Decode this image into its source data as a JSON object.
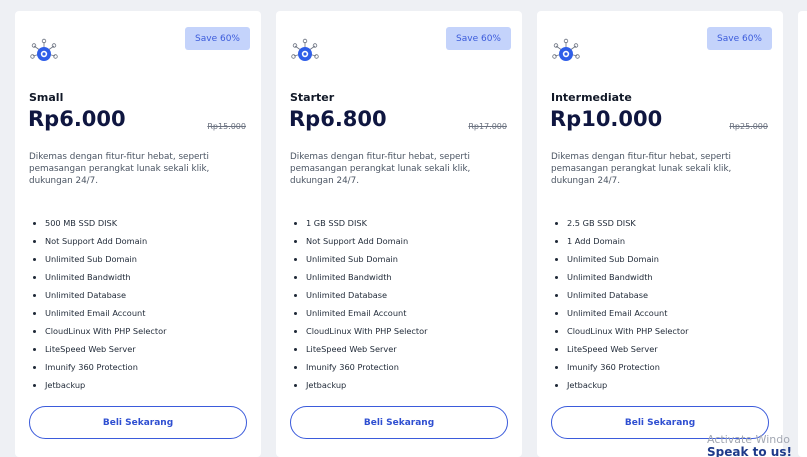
{
  "colors": {
    "accent": "#3b5bdb",
    "badge_bg": "#c4d3fb",
    "price": "#0f1640",
    "icon_blue": "#2f5ee8"
  },
  "plans": [
    {
      "badge": "Save 60%",
      "icon": "network-hub-icon",
      "name": "Small",
      "price": "Rp6.000",
      "old_price": "Rp15.000",
      "description": "Dikemas dengan fitur-fitur hebat, seperti pemasangan perangkat lunak sekali klik, dukungan 24/7.",
      "features": [
        "500 MB SSD DISK",
        "Not Support Add Domain",
        "Unlimited Sub Domain",
        "Unlimited Bandwidth",
        "Unlimited Database",
        "Unlimited Email Account",
        "CloudLinux With PHP Selector",
        "LiteSpeed Web Server",
        "Imunify 360 Protection",
        "Jetbackup"
      ],
      "button": "Beli Sekarang"
    },
    {
      "badge": "Save 60%",
      "icon": "network-hub-icon",
      "name": "Starter",
      "price": "Rp6.800",
      "old_price": "Rp17.000",
      "description": "Dikemas dengan fitur-fitur hebat, seperti pemasangan perangkat lunak sekali klik, dukungan 24/7.",
      "features": [
        "1 GB SSD DISK",
        "Not Support Add Domain",
        "Unlimited Sub Domain",
        "Unlimited Bandwidth",
        "Unlimited Database",
        "Unlimited Email Account",
        "CloudLinux With PHP Selector",
        "LiteSpeed Web Server",
        "Imunify 360 Protection",
        "Jetbackup"
      ],
      "button": "Beli Sekarang"
    },
    {
      "badge": "Save 60%",
      "icon": "network-hub-icon",
      "name": "Intermediate",
      "price": "Rp10.000",
      "old_price": "Rp25.000",
      "description": "Dikemas dengan fitur-fitur hebat, seperti pemasangan perangkat lunak sekali klik, dukungan 24/7.",
      "features": [
        "2.5 GB SSD DISK",
        "1 Add Domain",
        "Unlimited Sub Domain",
        "Unlimited Bandwidth",
        "Unlimited Database",
        "Unlimited Email Account",
        "CloudLinux With PHP Selector",
        "LiteSpeed Web Server",
        "Imunify 360 Protection",
        "Jetbackup"
      ],
      "button": "Beli Sekarang"
    }
  ],
  "overlay": {
    "watermark": "Activate Windo",
    "chat": "Speak to us!"
  }
}
